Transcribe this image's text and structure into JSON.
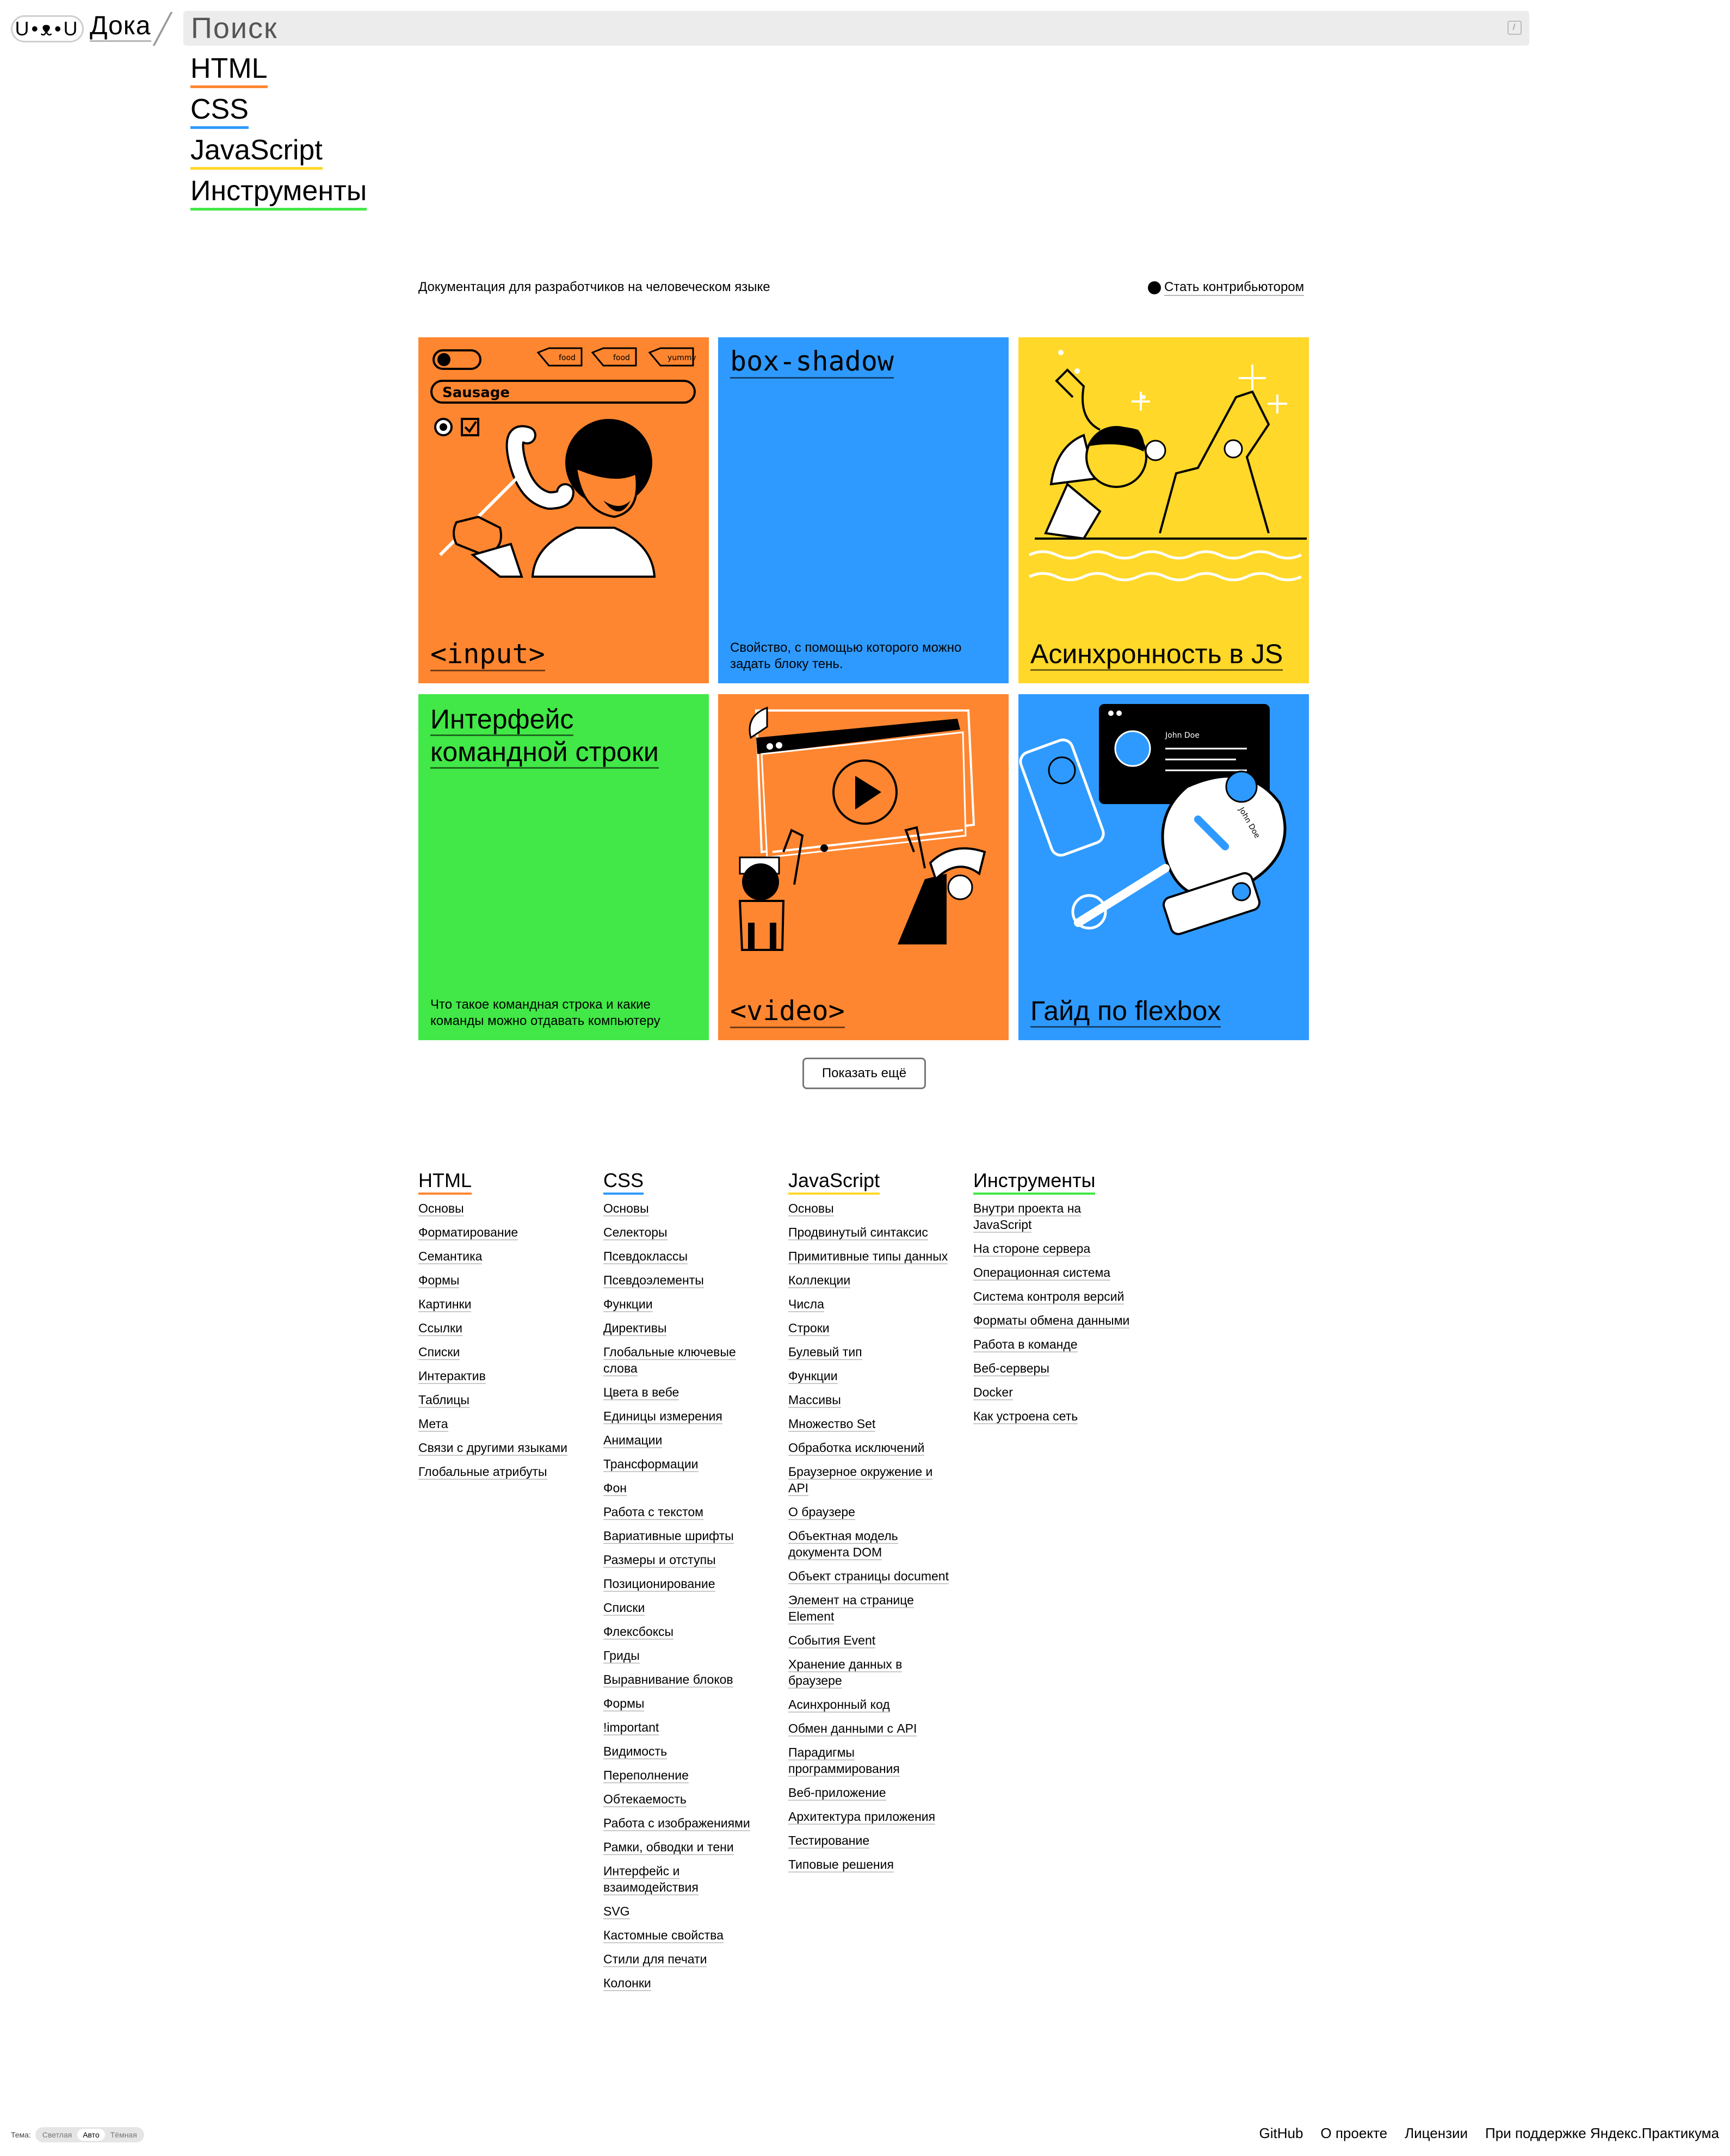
{
  "header": {
    "logo_text": "U•ᴥ•U",
    "brand": "Дока",
    "search_placeholder": "Поиск",
    "search_shortcut": "/"
  },
  "nav": [
    {
      "label": "HTML",
      "color": "#ff8630"
    },
    {
      "label": "CSS",
      "color": "#2e9aff"
    },
    {
      "label": "JavaScript",
      "color": "#ffd829"
    },
    {
      "label": "Инструменты",
      "color": "#41e847"
    }
  ],
  "intro": {
    "tagline": "Документация для разработчиков на человеческом языке",
    "contribute": "Стать контрибьютором"
  },
  "cards": [
    {
      "title": "<input>",
      "color": "#ff8630",
      "illustration_text": [
        "food",
        "food",
        "yummy",
        "Sausage"
      ]
    },
    {
      "title": "box-shadow",
      "color": "#2e9aff",
      "desc": "Свойство, с помощью которого можно задать блоку тень."
    },
    {
      "title": "Асинхронность в JS",
      "color": "#ffd829"
    },
    {
      "title": "Интерфейс командной строки",
      "color": "#41e847",
      "desc": "Что такое командная строка и какие команды можно отдавать компьютеру"
    },
    {
      "title": "<video>",
      "color": "#ff8630"
    },
    {
      "title": "Гайд по flexbox",
      "color": "#2e9aff",
      "illustration_text": [
        "John Doe",
        "John Doe"
      ]
    }
  ],
  "show_more": "Показать ещё",
  "footer": {
    "html": {
      "title": "HTML",
      "links": [
        "Основы",
        "Форматирование",
        "Семантика",
        "Формы",
        "Картинки",
        "Ссылки",
        "Списки",
        "Интерактив",
        "Таблицы",
        "Мета",
        "Связи с другими языками",
        "Глобальные атрибуты"
      ]
    },
    "css": {
      "title": "CSS",
      "links": [
        "Основы",
        "Селекторы",
        "Псевдоклассы",
        "Псевдоэлементы",
        "Функции",
        "Директивы",
        "Глобальные ключевые слова",
        "Цвета в вебе",
        "Единицы измерения",
        "Анимации",
        "Трансформации",
        "Фон",
        "Работа с текстом",
        "Вариативные шрифты",
        "Размеры и отступы",
        "Позиционирование",
        "Списки",
        "Флексбоксы",
        "Гриды",
        "Выравнивание блоков",
        "Формы",
        "!important",
        "Видимость",
        "Переполнение",
        "Обтекаемость",
        "Работа с изображениями",
        "Рамки, обводки и тени",
        "Интерфейс и взаимодействия",
        "SVG",
        "Кастомные свойства",
        "Стили для печати",
        "Колонки"
      ]
    },
    "js": {
      "title": "JavaScript",
      "links": [
        "Основы",
        "Продвинутый синтаксис",
        "Примитивные типы данных",
        "Коллекции",
        "Числа",
        "Строки",
        "Булевый тип",
        "Функции",
        "Массивы",
        "Множество Set",
        "Обработка исключений",
        "Браузерное окружение и API",
        "О браузере",
        "Объектная модель документа DOM",
        "Объект страницы document",
        "Элемент на странице Element",
        "События Event",
        "Хранение данных в браузере",
        "Асинхронный код",
        "Обмен данными с API",
        "Парадигмы программирования",
        "Веб-приложение",
        "Архитектура приложения",
        "Тестирование",
        "Типовые решения"
      ]
    },
    "tools": {
      "title": "Инструменты",
      "links": [
        "Внутри проекта на JavaScript",
        "На стороне сервера",
        "Операционная система",
        "Система контроля версий",
        "Форматы обмена данными",
        "Работа в команде",
        "Веб-серверы",
        "Docker",
        "Как устроена сеть"
      ]
    }
  },
  "theme": {
    "label": "Тема:",
    "options": [
      "Светлая",
      "Авто",
      "Тёмная"
    ],
    "selected": "Авто"
  },
  "bottom_links": [
    "GitHub",
    "О проекте",
    "Лицензии",
    "При поддержке Яндекс.Практикума"
  ]
}
